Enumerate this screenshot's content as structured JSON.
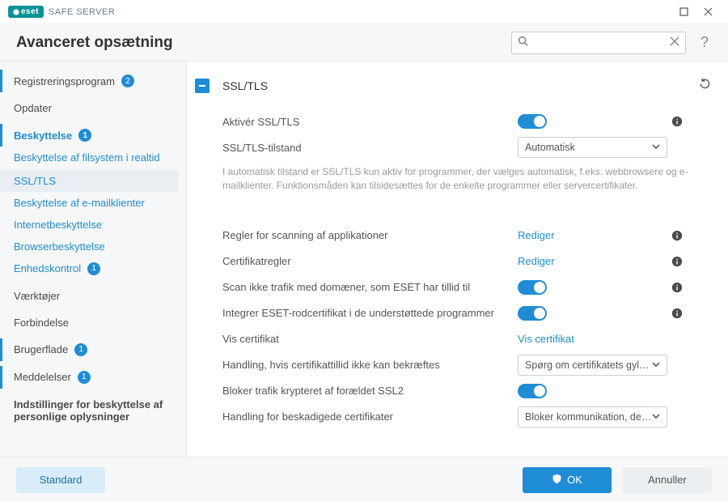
{
  "titlebar": {
    "brand": "eset",
    "product": "SAFE SERVER"
  },
  "header": {
    "title": "Avanceret opsætning",
    "search_placeholder": "",
    "help": "?"
  },
  "sidebar": {
    "items": [
      {
        "label": "Registreringsprogram",
        "badge": "2"
      },
      {
        "label": "Opdater"
      },
      {
        "label": "Beskyttelse",
        "badge": "1",
        "active": true
      },
      {
        "label": "Beskyttelse af filsystem i realtid",
        "sub": true
      },
      {
        "label": "SSL/TLS",
        "sub": true,
        "selected": true
      },
      {
        "label": "Beskyttelse af e-mailklienter",
        "sub": true
      },
      {
        "label": "Internetbeskyttelse",
        "sub": true
      },
      {
        "label": "Browserbeskyttelse",
        "sub": true
      },
      {
        "label": "Enhedskontrol",
        "sub": true,
        "badge": "1"
      },
      {
        "label": "Værktøjer"
      },
      {
        "label": "Forbindelse"
      },
      {
        "label": "Brugerflade",
        "badge": "1"
      },
      {
        "label": "Meddelelser",
        "badge": "1"
      },
      {
        "label": "Indstillinger for beskyttelse af personlige oplysninger"
      }
    ]
  },
  "section": {
    "title": "SSL/TLS",
    "rows": {
      "enable": {
        "label": "Aktivér SSL/TLS"
      },
      "mode": {
        "label": "SSL/TLS-tilstand",
        "value": "Automatisk"
      },
      "desc": "I automatisk tilstand er SSL/TLS kun aktiv for programmer, der vælges automatisk, f.eks. webbrowsere og e-mailklienter. Funktionsmåden kan tilsidesættes for de enkelte programmer eller servercertifikater.",
      "scan_rules": {
        "label": "Regler for scanning af applikationer",
        "action": "Rediger"
      },
      "cert_rules": {
        "label": "Certifikatregler",
        "action": "Rediger"
      },
      "trust_domains": {
        "label": "Scan ikke trafik med domæner, som ESET har tillid til"
      },
      "root_cert": {
        "label": "Integrer ESET-rodcertifikat i de understøttede programmer"
      },
      "view_cert": {
        "label": "Vis certifikat",
        "action": "Vis certifikat"
      },
      "untrusted": {
        "label": "Handling, hvis certifikattillid ikke kan bekræftes",
        "value": "Spørg om certifikatets gyldi..."
      },
      "block_ssl2": {
        "label": "Bloker trafik krypteret af forældet SSL2"
      },
      "damaged": {
        "label": "Handling for beskadigede certifikater",
        "value": "Bloker kommunikation, der b..."
      }
    }
  },
  "footer": {
    "default": "Standard",
    "ok": "OK",
    "cancel": "Annuller"
  }
}
